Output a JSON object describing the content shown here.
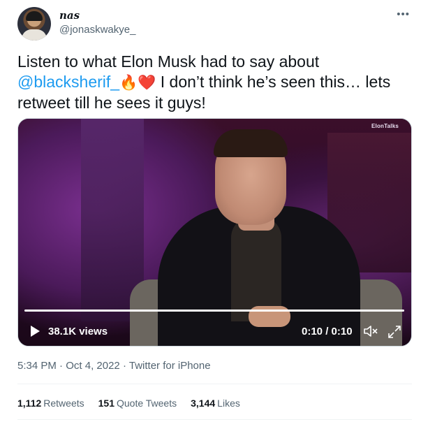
{
  "author": {
    "display_name": "nas",
    "handle": "@jonaskwakye_"
  },
  "tweet": {
    "text_before_mention": "Listen to what Elon Musk had to say about",
    "mention": "@blacksherif_",
    "emoji_fire": "🔥",
    "emoji_heart": "❤️",
    "text_after_emoji": " I don’t think he’s seen this… lets retweet till he sees it guys!"
  },
  "video": {
    "watermark": "ElonTalks",
    "views": "38.1K views",
    "time": "0:10 / 0:10",
    "progress": 1.0
  },
  "meta": {
    "time": "5:34 PM",
    "date": "Oct 4, 2022",
    "source": "Twitter for iPhone"
  },
  "stats": {
    "retweets_count": "1,112",
    "retweets_label": "Retweets",
    "quotes_count": "151",
    "quotes_label": "Quote Tweets",
    "likes_count": "3,144",
    "likes_label": "Likes"
  },
  "icons": {
    "more": "more-horizontal-icon",
    "play": "play-icon",
    "mute": "mute-icon",
    "expand": "expand-icon"
  },
  "colors": {
    "accent": "#1d9bf0",
    "text": "#0f1419",
    "muted": "#536471"
  }
}
